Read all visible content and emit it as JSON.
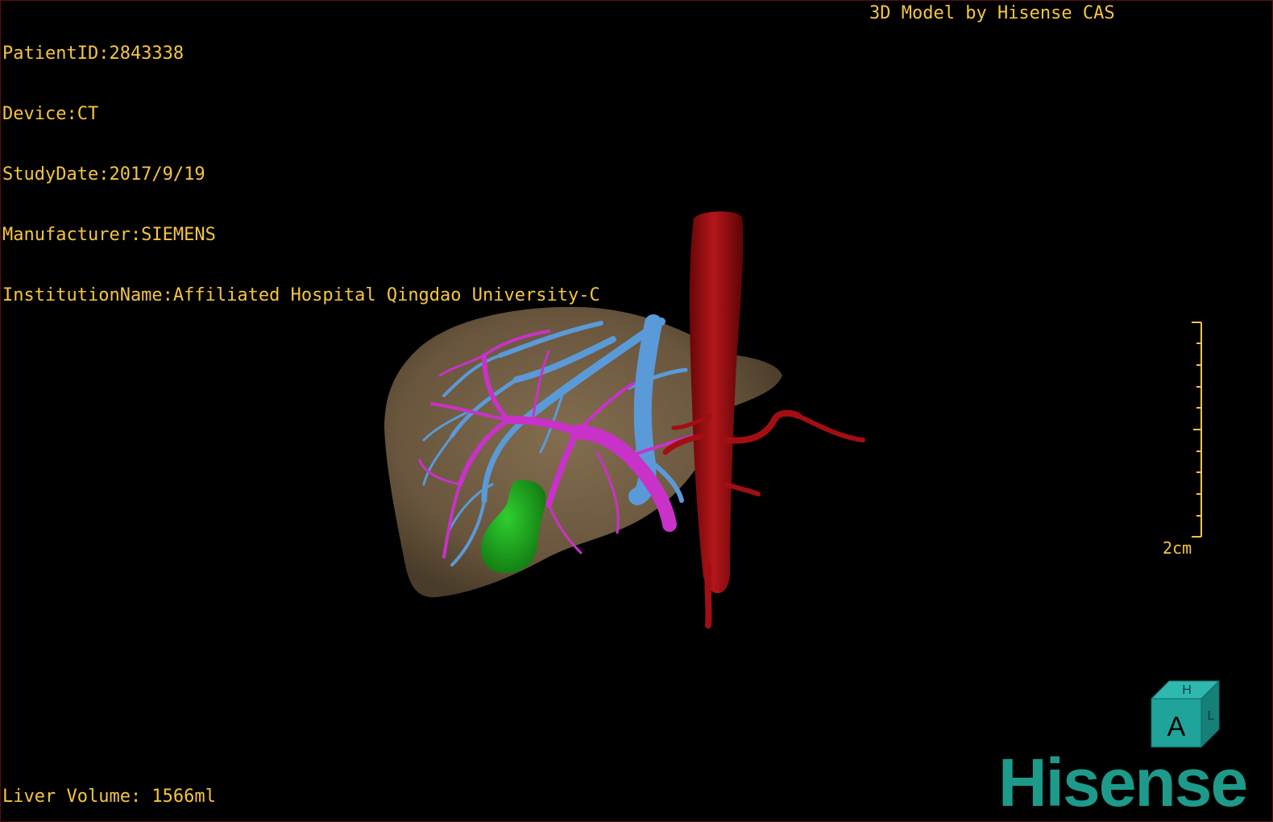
{
  "study_info": {
    "lines": [
      "PatientID:2843338",
      "Device:CT",
      "StudyDate:2017/9/19",
      "Manufacturer:SIEMENS",
      "InstitutionName:Affiliated Hospital Qingdao University-C"
    ]
  },
  "header": {
    "credit": "3D Model by Hisense CAS"
  },
  "footer": {
    "liver_volume": "Liver Volume: 1566ml"
  },
  "scale_bar": {
    "label": "2cm"
  },
  "orientation_cube": {
    "front_label": "A",
    "top_label": "H",
    "side_label": "L"
  },
  "brand": {
    "logo_text": "Hisense"
  },
  "colors": {
    "overlay_text": "#f5c542",
    "liver": "#7a6548",
    "portal_vein": "#c832c8",
    "hepatic_vein": "#5a9ad8",
    "artery": "#9e0e10",
    "gallbladder": "#1fa31f",
    "brand": "#1d9a8a"
  }
}
